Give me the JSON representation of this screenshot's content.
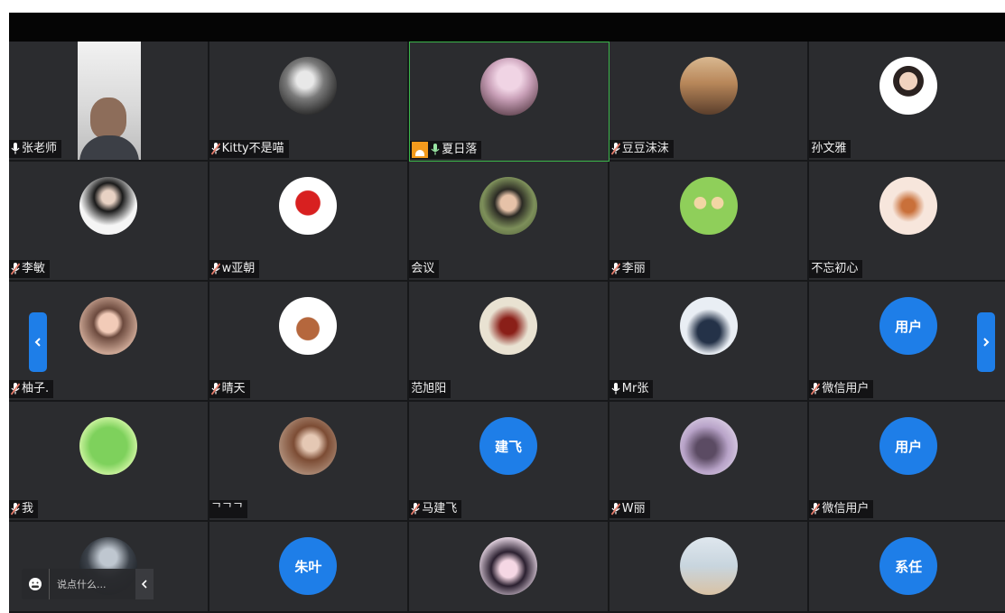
{
  "colors": {
    "tile_bg": "#2b2c2f",
    "accent_blue": "#1e7ee8",
    "active_border": "#3bb54a",
    "host_badge": "#f39a1d",
    "mic_muted": "#e47c6b",
    "mic_active": "#9ae6a4"
  },
  "participants": [
    {
      "name": "张老师",
      "mic": "white",
      "avatar_type": "video",
      "avatar_desc": "man-webcam"
    },
    {
      "name": "Kitty不是喵",
      "mic": "muted",
      "avatar_type": "photo",
      "avatar_desc": "grayscale-person"
    },
    {
      "name": "夏日落",
      "mic": "active",
      "host": true,
      "avatar_type": "photo",
      "avatar_desc": "flower-portrait"
    },
    {
      "name": "豆豆沫沫",
      "mic": "muted",
      "avatar_type": "photo",
      "avatar_desc": "sunset-silhouette"
    },
    {
      "name": "孙文雅",
      "mic": "none",
      "avatar_type": "photo",
      "avatar_desc": "woman-portrait"
    },
    {
      "name": "李敏",
      "mic": "muted",
      "avatar_type": "photo",
      "avatar_desc": "woman-black-dress"
    },
    {
      "name": "w亚朝",
      "mic": "muted",
      "avatar_type": "photo",
      "avatar_desc": "red-cartoon"
    },
    {
      "name": "会议",
      "mic": "none",
      "avatar_type": "photo",
      "avatar_desc": "older-woman-outdoor"
    },
    {
      "name": "李丽",
      "mic": "muted",
      "avatar_type": "photo",
      "avatar_desc": "cartoon-kids"
    },
    {
      "name": "不忘初心",
      "mic": "none",
      "avatar_type": "photo",
      "avatar_desc": "deer-illustration"
    },
    {
      "name": "柚子.",
      "mic": "muted",
      "avatar_type": "photo",
      "avatar_desc": "girl-portrait"
    },
    {
      "name": "晴天",
      "mic": "muted",
      "avatar_type": "photo",
      "avatar_desc": "jerry-mouse"
    },
    {
      "name": "范旭阳",
      "mic": "none",
      "avatar_type": "photo",
      "avatar_desc": "red-object-blur"
    },
    {
      "name": "Mr张",
      "mic": "white",
      "avatar_type": "photo",
      "avatar_desc": "couple-photo"
    },
    {
      "name": "微信用户",
      "mic": "muted",
      "avatar_type": "text",
      "avatar_text": "用户"
    },
    {
      "name": "我",
      "mic": "muted",
      "avatar_type": "photo",
      "avatar_desc": "frog-cartoon"
    },
    {
      "name": "ᄀᄀᄀ",
      "mic": "none",
      "avatar_type": "photo",
      "avatar_desc": "girl-hair"
    },
    {
      "name": "马建飞",
      "mic": "muted",
      "avatar_type": "text",
      "avatar_text": "建飞"
    },
    {
      "name": "W丽",
      "mic": "muted",
      "avatar_type": "photo",
      "avatar_desc": "couple-lying"
    },
    {
      "name": "微信用户",
      "mic": "muted",
      "avatar_type": "text",
      "avatar_text": "用户"
    },
    {
      "name": "",
      "mic": "none",
      "avatar_type": "photo",
      "avatar_desc": "ok-hand-dark"
    },
    {
      "name": "",
      "mic": "none",
      "avatar_type": "text",
      "avatar_text": "朱叶"
    },
    {
      "name": "",
      "mic": "none",
      "avatar_type": "photo",
      "avatar_desc": "kuromi-cartoon"
    },
    {
      "name": "",
      "mic": "none",
      "avatar_type": "photo",
      "avatar_desc": "beach-scene"
    },
    {
      "name": "",
      "mic": "none",
      "avatar_type": "text",
      "avatar_text": "系任"
    }
  ],
  "chat": {
    "placeholder": "说点什么..."
  },
  "nav": {
    "prev_icon": "chevron-left-icon",
    "next_icon": "chevron-right-icon"
  }
}
